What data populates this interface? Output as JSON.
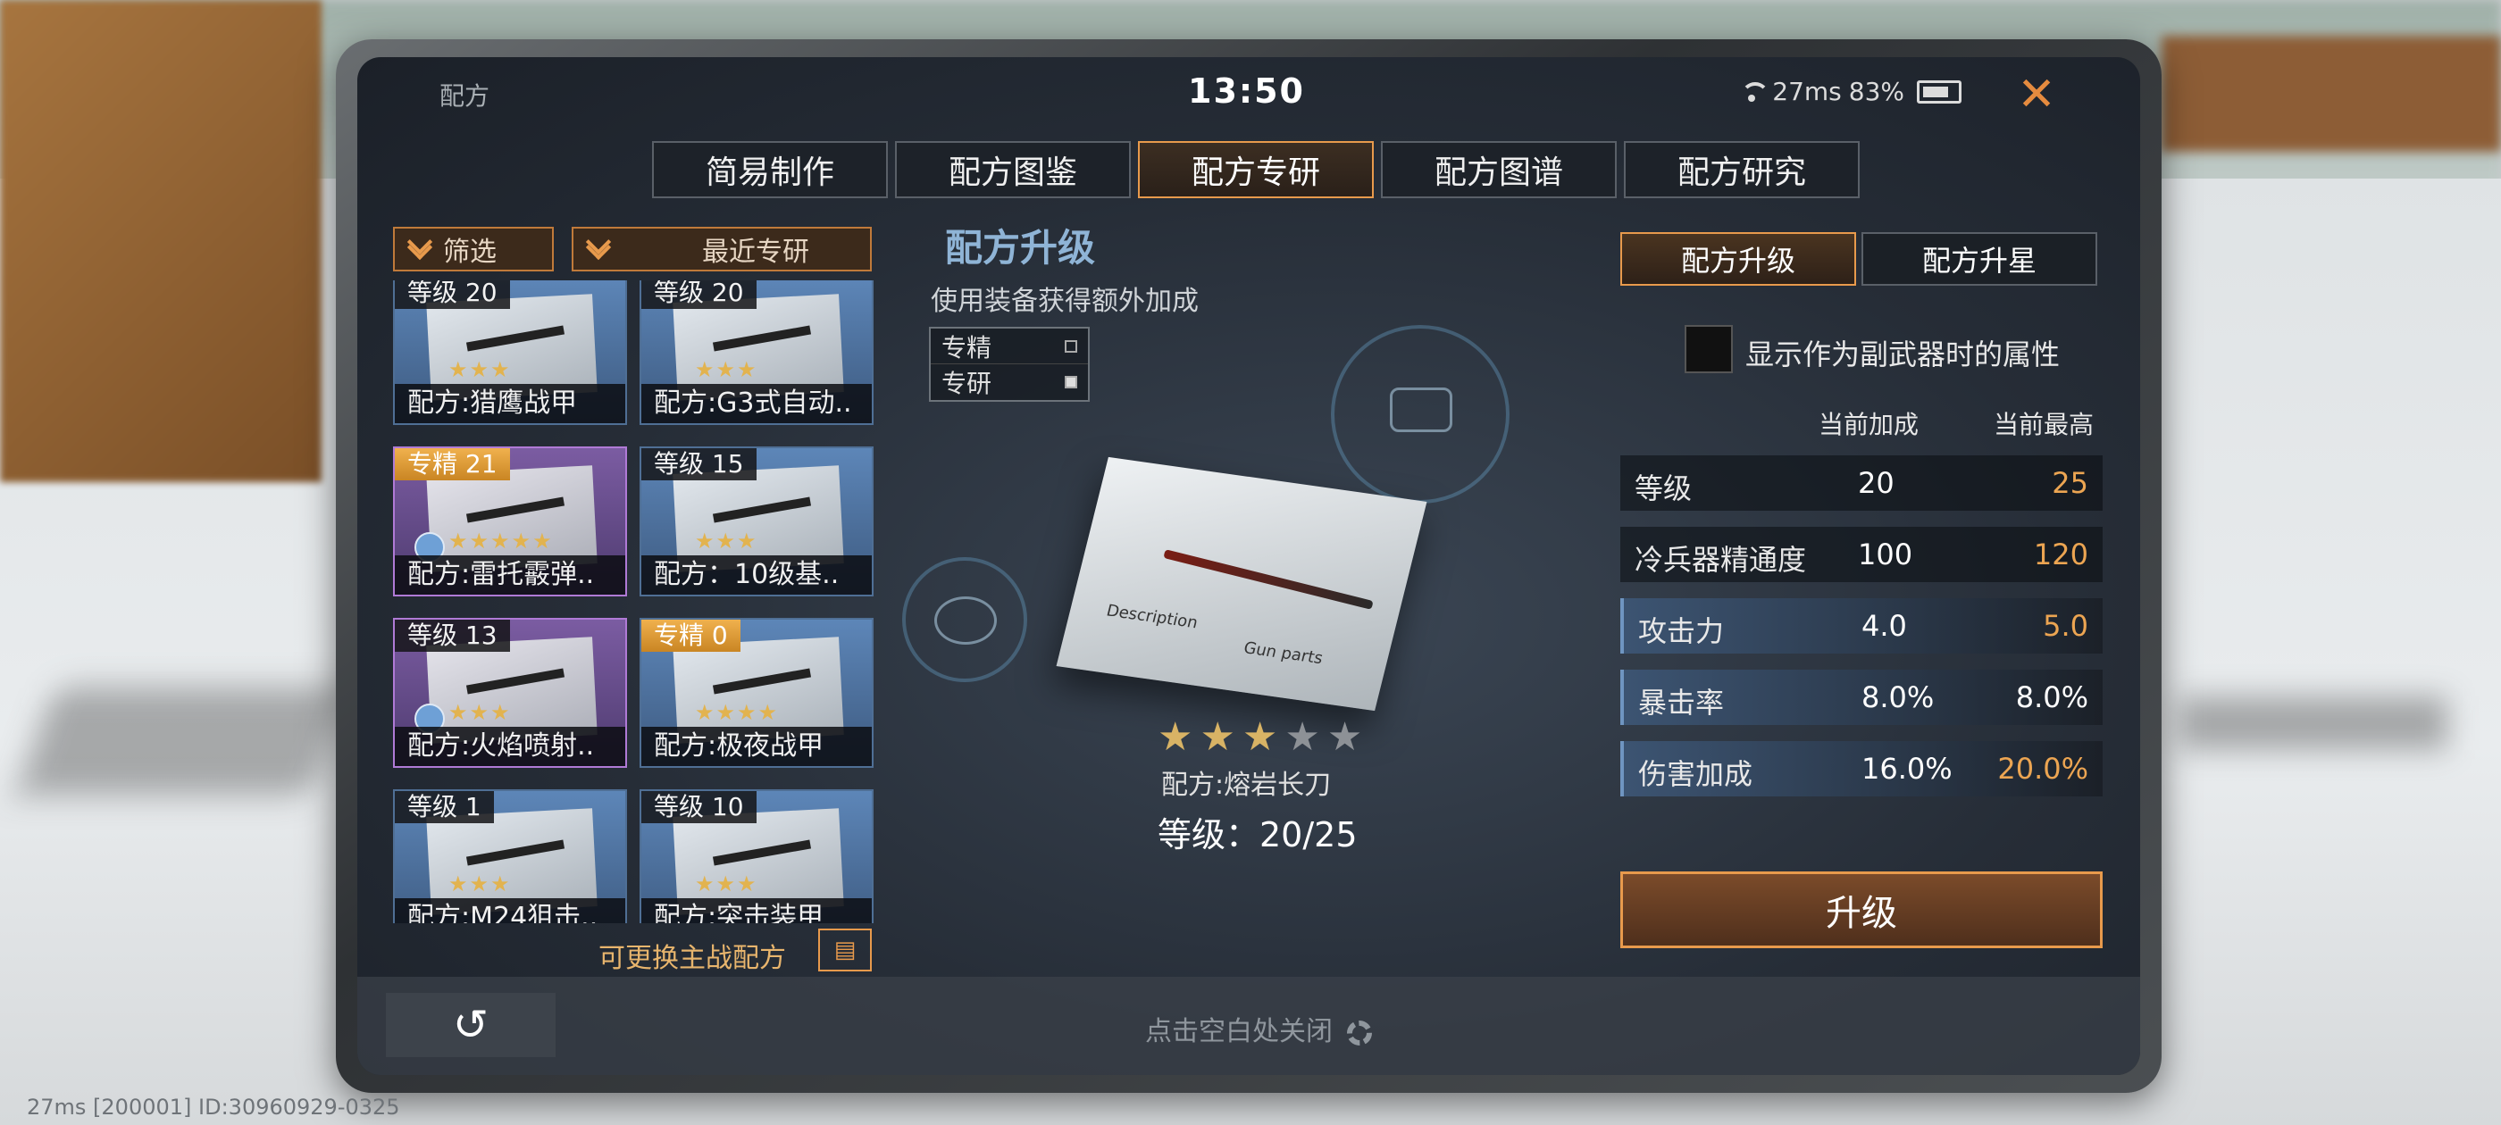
{
  "header": {
    "title": "配方",
    "clock": "13:50",
    "ping": "27ms",
    "battery": "83%",
    "close_symbol": "✕"
  },
  "tabs": [
    {
      "label": "简易制作"
    },
    {
      "label": "配方图鉴"
    },
    {
      "label": "配方专研",
      "active": true
    },
    {
      "label": "配方图谱"
    },
    {
      "label": "配方研究"
    }
  ],
  "left": {
    "filter_label": "筛选",
    "recent_label": "最近专研",
    "cards": [
      {
        "badge": "等级 20",
        "name": "配方:猎鹰战甲",
        "stars": "★★★"
      },
      {
        "badge": "等级 20",
        "name": "配方:G3式自动..",
        "stars": "★★★"
      },
      {
        "badge": "专精 21",
        "name": "配方:雷托霰弹..",
        "stars": "★★★★★"
      },
      {
        "badge": "等级 15",
        "name": "配方：10级基..",
        "stars": "★★★"
      },
      {
        "badge": "等级 13",
        "name": "配方:火焰喷射..",
        "stars": "★★★"
      },
      {
        "badge": "专精 0",
        "name": "配方:极夜战甲",
        "stars": "★★★★"
      },
      {
        "badge": "等级 1",
        "name": "配方:M24狙击..",
        "stars": "★★★"
      },
      {
        "badge": "等级 10",
        "name": "配方:突击装甲",
        "stars": "★★★"
      }
    ],
    "swap_label": "可更换主战配方"
  },
  "center": {
    "title": "配方升级",
    "subtitle": "使用装备获得额外加成",
    "legend": [
      {
        "label": "专精"
      },
      {
        "label": "专研"
      }
    ],
    "blueprint_text_1": "Description",
    "blueprint_text_2": "Gun parts",
    "item_stars_filled": 3,
    "item_stars_total": 5,
    "item_name": "配方:熔岩长刀",
    "item_level": "等级：20/25"
  },
  "right": {
    "tab_upgrade": "配方升级",
    "tab_star": "配方升星",
    "secondary_label": "显示作为副武器时的属性",
    "col_current": "当前加成",
    "col_max": "当前最高",
    "stats": [
      {
        "key": "等级",
        "current": "20",
        "max": "25"
      },
      {
        "key": "冷兵器精通度",
        "current": "100",
        "max": "120"
      },
      {
        "key": "攻击力",
        "current": "4.0",
        "max": "5.0"
      },
      {
        "key": "暴击率",
        "current": "8.0%",
        "max": "8.0%"
      },
      {
        "key": "伤害加成",
        "current": "16.0%",
        "max": "20.0%"
      }
    ],
    "upgrade_label": "升级"
  },
  "bottom": {
    "back_symbol": "↺",
    "close_hint": "点击空白处关闭"
  },
  "debug": {
    "text": "27ms  [200001] ID:30960929-0325"
  }
}
